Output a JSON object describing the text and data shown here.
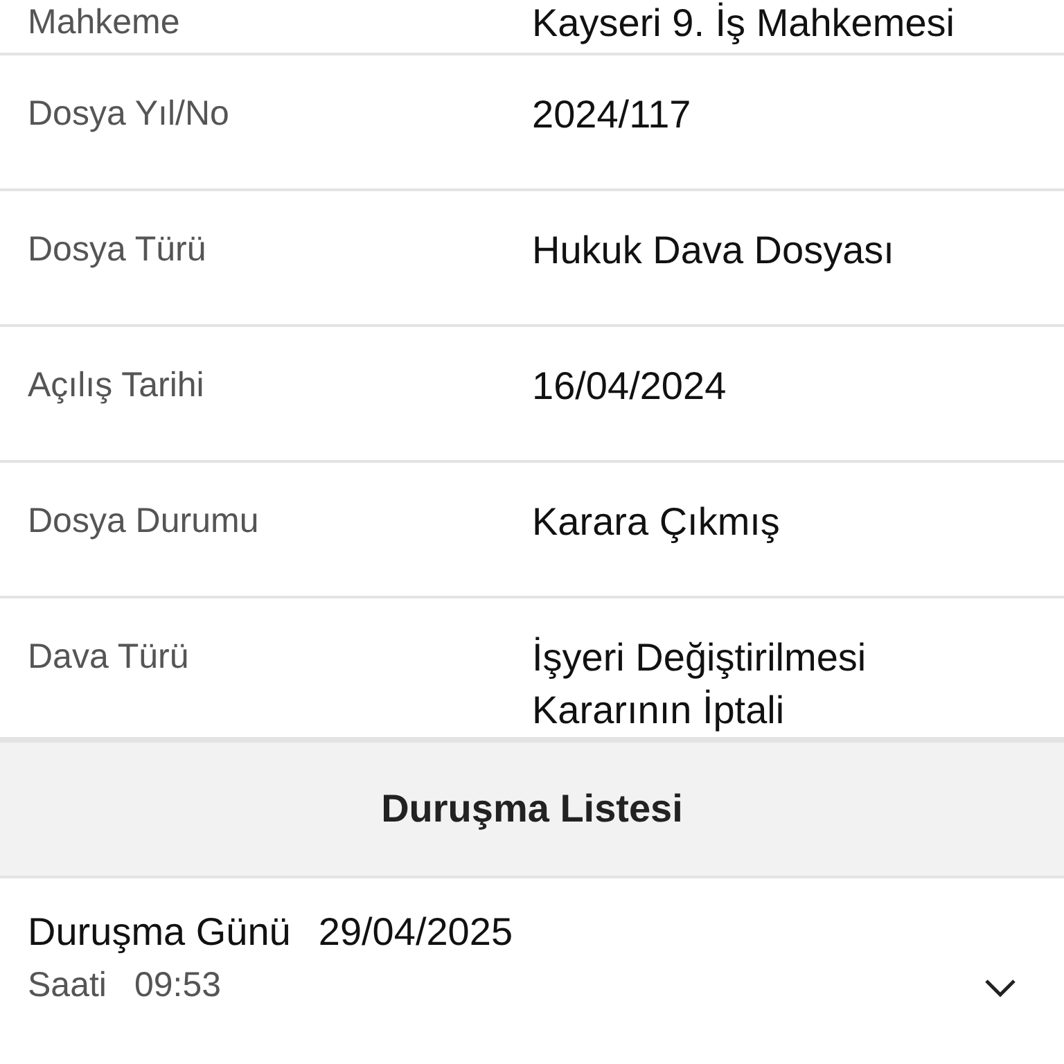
{
  "details": [
    {
      "label": "Mahkeme",
      "value": "Kayseri 9. İş Mahkemesi"
    },
    {
      "label": "Dosya Yıl/No",
      "value": "2024/117"
    },
    {
      "label": "Dosya Türü",
      "value": "Hukuk Dava Dosyası"
    },
    {
      "label": "Açılış Tarihi",
      "value": "16/04/2024"
    },
    {
      "label": "Dosya Durumu",
      "value": "Karara Çıkmış"
    },
    {
      "label": "Dava Türü",
      "value": "İşyeri Değiştirilmesi Kararının İptali"
    }
  ],
  "hearing_list": {
    "title": "Duruşma Listesi",
    "items": [
      {
        "day_label": "Duruşma Günü",
        "day": "29/04/2025",
        "time_label": "Saati",
        "time": "09:53",
        "expanded": false
      }
    ]
  }
}
